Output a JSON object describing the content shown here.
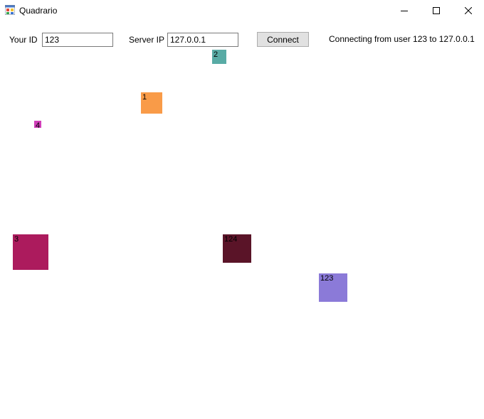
{
  "window": {
    "title": "Quadrario",
    "controls": {
      "minimize": "minimize-icon",
      "maximize": "maximize-icon",
      "close": "close-icon"
    }
  },
  "toolbar": {
    "your_id_label": "Your ID",
    "your_id_value": "123",
    "server_ip_label": "Server IP",
    "server_ip_value": "127.0.0.1",
    "connect_label": "Connect",
    "status": "Connecting from user 123 to 127.0.0.1"
  },
  "players": [
    {
      "id": "2",
      "color": "#58aba5"
    },
    {
      "id": "1",
      "color": "#f99b48"
    },
    {
      "id": "4",
      "color": "#d13fb9"
    },
    {
      "id": "3",
      "color": "#ac1b5d"
    },
    {
      "id": "124",
      "color": "#5a1428"
    },
    {
      "id": "123",
      "color": "#8b7ad8"
    }
  ]
}
